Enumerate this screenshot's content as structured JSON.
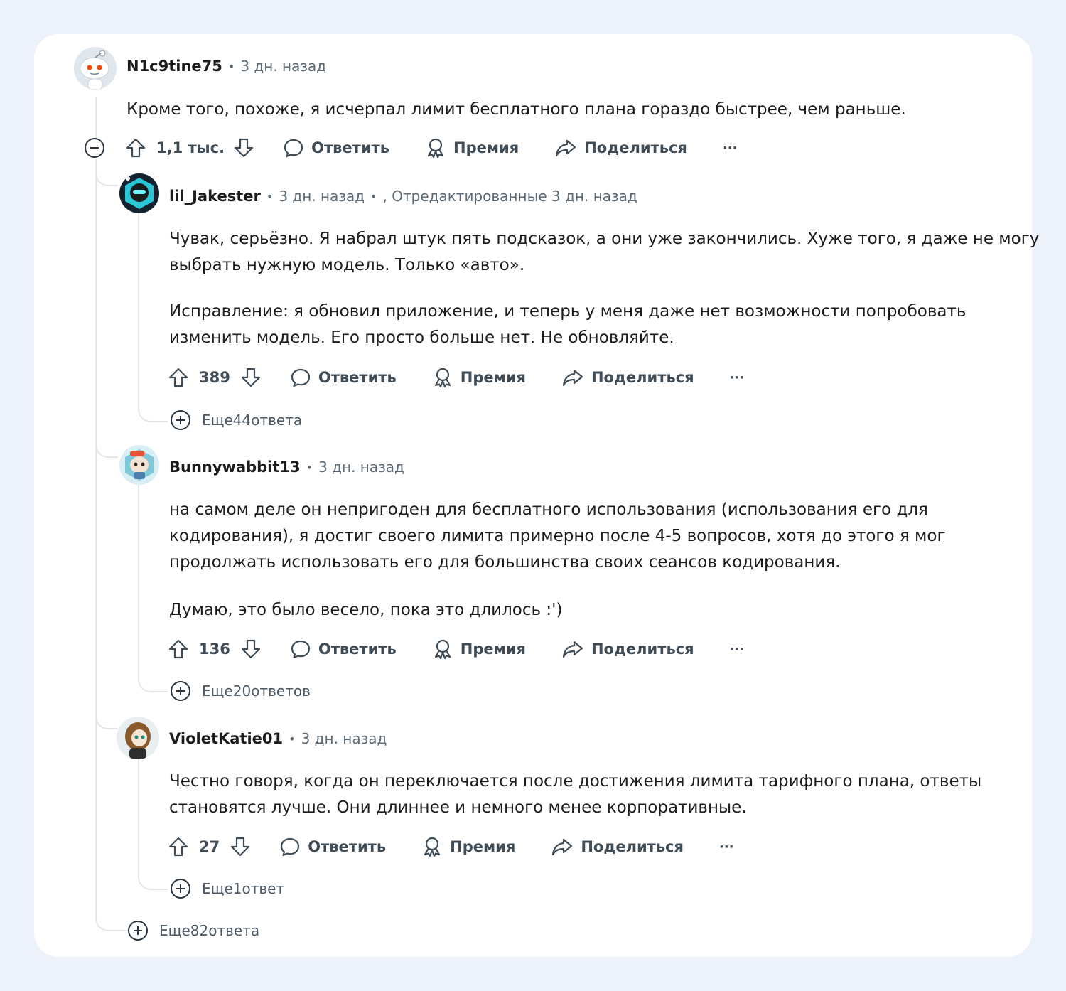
{
  "root_comment": {
    "author": "N1c9tine75",
    "time": "3 дн. назад",
    "text": "Кроме того, похоже, я исчерпал лимит бесплатного плана гораздо быстрее, чем раньше.",
    "score": "1,1 тыс.",
    "more_replies": "Еще82ответа"
  },
  "actions": {
    "reply": "Ответить",
    "award": "Премия",
    "share": "Поделиться",
    "more": "···"
  },
  "replies": [
    {
      "author": "lil_Jakester",
      "time": "3 дн. назад",
      "edited": ", Отредактированные 3 дн. назад",
      "paragraphs": [
        [
          "Чувак, серьёзно. Я набрал штук пять подсказок, а они уже закончились. Хуже того, я даже не могу",
          "выбрать нужную модель. Только «авто»."
        ],
        [
          "Исправление: я обновил приложение, и теперь у меня даже нет возможности попробовать",
          "изменить модель. Его просто больше нет. Не обновляйте."
        ]
      ],
      "score": "389",
      "more_replies": "Еще44ответа"
    },
    {
      "author": "Bunnywabbit13",
      "time": "3 дн. назад",
      "paragraphs": [
        [
          "на самом деле он непригоден для бесплатного использования (использования его для",
          "кодирования), я достиг своего лимита примерно после 4-5 вопросов, хотя до этого я мог",
          "продолжать использовать его для большинства своих сеансов кодирования."
        ],
        [
          "Думаю, это было весело, пока это длилось :')"
        ]
      ],
      "score": "136",
      "more_replies": "Еще20ответов"
    },
    {
      "author": "VioletKatie01",
      "time": "3 дн. назад",
      "paragraphs": [
        [
          "Честно говоря, когда он переключается после достижения лимита тарифного плана, ответы",
          "становятся лучше. Они длиннее и немного менее корпоративные."
        ]
      ],
      "score": "27",
      "more_replies": "Еще1ответ"
    }
  ],
  "icons": [
    "upvote-icon",
    "downvote-icon",
    "comment-icon",
    "award-icon",
    "share-icon",
    "expand-icon",
    "collapse-icon"
  ]
}
